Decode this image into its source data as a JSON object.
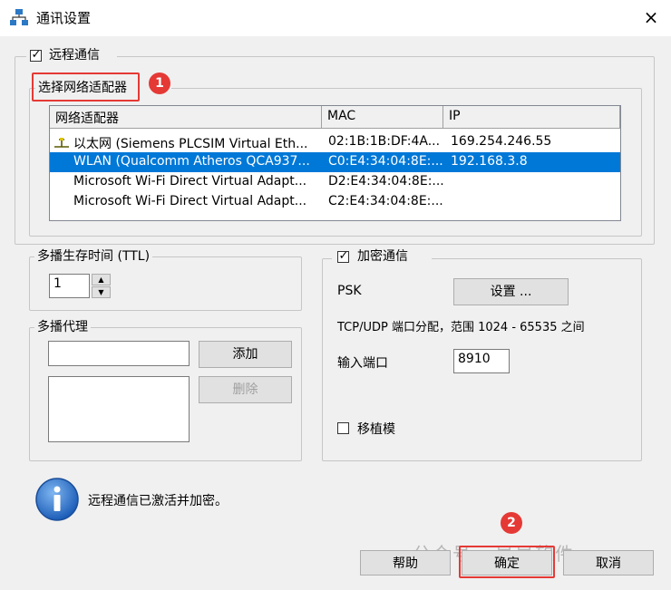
{
  "window": {
    "title": "通讯设置",
    "close": "×"
  },
  "remote": {
    "checkbox_label": "远程通信",
    "checked": "✓",
    "adapter_group_label": "选择网络适配器",
    "columns": [
      "网络适配器",
      "MAC",
      "IP"
    ],
    "rows": [
      {
        "name": "以太网 (Siemens PLCSIM Virtual Eth...",
        "mac": "02:1B:1B:DF:4A...",
        "ip": "169.254.246.55"
      },
      {
        "name": "WLAN (Qualcomm Atheros QCA937...",
        "mac": "C0:E4:34:04:8E:...",
        "ip": "192.168.3.8"
      },
      {
        "name": "Microsoft Wi-Fi Direct Virtual Adapt...",
        "mac": "D2:E4:34:04:8E:...",
        "ip": ""
      },
      {
        "name": "Microsoft Wi-Fi Direct Virtual Adapt...",
        "mac": "C2:E4:34:04:8E:...",
        "ip": ""
      }
    ]
  },
  "ttl": {
    "label": "多播生存时间 (TTL)",
    "value": "1"
  },
  "proxy": {
    "label": "多播代理",
    "add": "添加",
    "remove": "删除"
  },
  "encryption": {
    "checkbox_label": "加密通信",
    "checked": "✓",
    "psk_label": "PSK",
    "settings_button": "设置 ...",
    "port_range": "TCP/UDP 端口分配，范围 1024 - 65535 之间",
    "port_label": "输入端口",
    "port_value": "8910",
    "migrate_label": "移植模"
  },
  "status": {
    "message": "远程通信已激活并加密。"
  },
  "buttons": {
    "help": "帮助",
    "ok": "确定",
    "cancel": "取消"
  },
  "annotations": {
    "badge1": "1",
    "badge2": "2"
  },
  "watermark": "公众号 · 早早软件",
  "colors": {
    "selection": "#0078d7",
    "highlight": "#e53935"
  }
}
